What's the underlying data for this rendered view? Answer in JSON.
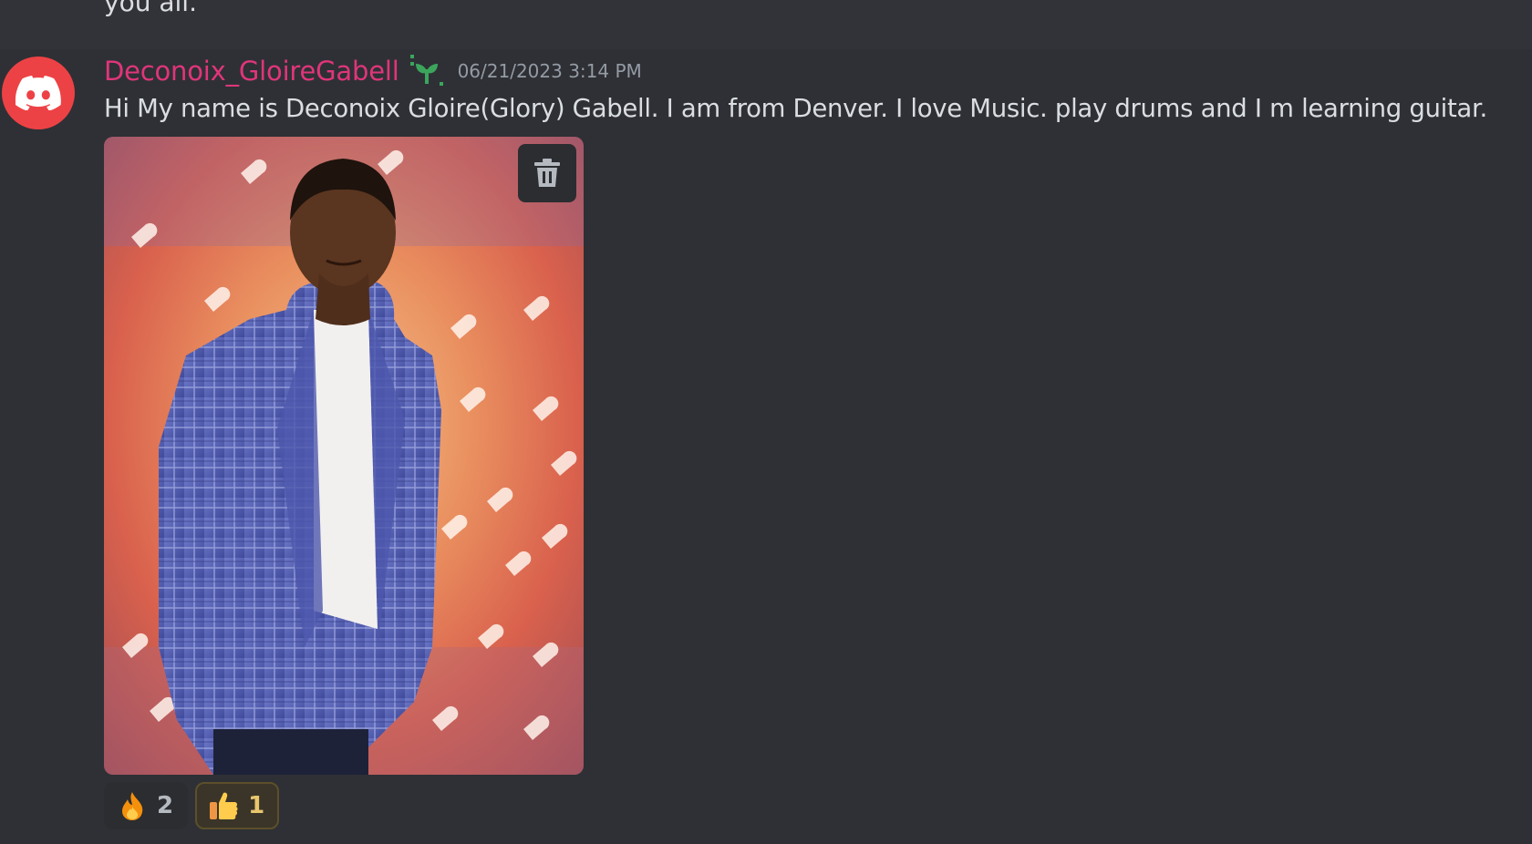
{
  "previous_message": {
    "text": "you all."
  },
  "message": {
    "avatar": "discord-logo-icon",
    "username": "Deconoix_GloireGabell",
    "role_icon": "sprout-icon",
    "timestamp": "06/21/2023 3:14 PM",
    "content": "Hi My name is Deconoix Gloire(Glory) Gabell. I am from Denver. I love Music. play drums and I m learning guitar.",
    "attachment": {
      "type": "image",
      "description_icon": "photo-attachment",
      "delete_action": "trash-icon"
    },
    "reactions": [
      {
        "emoji": "fire-icon",
        "count": "2",
        "selected": false
      },
      {
        "emoji": "thumbs-up-icon",
        "count": "1",
        "selected": true
      }
    ]
  },
  "colors": {
    "background": "#313338",
    "hover_background": "#2e3035",
    "username": "#e0357a",
    "avatar": "#ed4245",
    "timestamp": "#949ba4",
    "text": "#dbdee1"
  }
}
